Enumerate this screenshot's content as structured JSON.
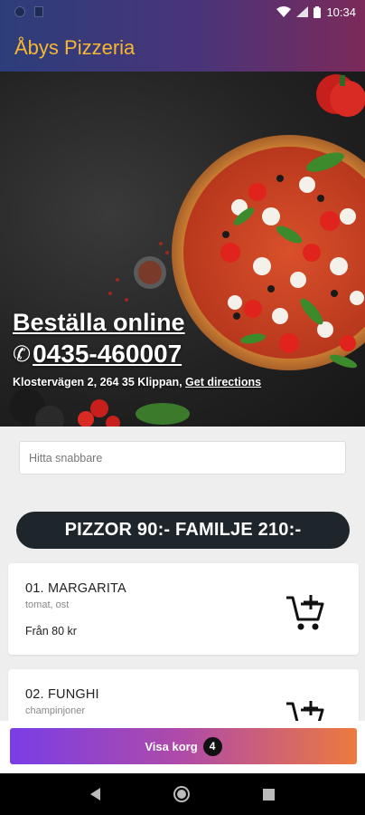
{
  "status_bar": {
    "time": "10:34",
    "left_icons": [
      "notification-dot-icon",
      "sd-card-icon"
    ],
    "right_icons": [
      "wifi-icon",
      "signal-icon",
      "battery-icon"
    ]
  },
  "app_bar": {
    "title": "Åbys Pizzeria"
  },
  "hero": {
    "title": "Beställa online",
    "phone_icon": "phone-icon",
    "phone": "0435-460007",
    "address": "Klostervägen 2, 264 35 Klippan, ",
    "directions_label": "Get directions"
  },
  "search": {
    "placeholder": "Hitta snabbare",
    "value": ""
  },
  "banner": {
    "text": "PIZZOR 90:- FAMILJE 210:-"
  },
  "menu_items": [
    {
      "name": "01. MARGARITA",
      "description": "tomat, ost",
      "price": "Från 80 kr",
      "icon": "add-to-cart-icon"
    },
    {
      "name": "02. FUNGHI",
      "description": "champinjoner",
      "price": "",
      "icon": "add-to-cart-icon"
    }
  ],
  "cart_button": {
    "label": "Visa korg",
    "count": "4"
  },
  "nav_bar": {
    "icons": [
      "back-icon",
      "home-icon",
      "recents-icon"
    ]
  },
  "colors": {
    "app_title": "#f6b731",
    "banner_bg": "#1e262b",
    "cart_gradient_start": "#7a3de6",
    "cart_gradient_end": "#ec7a3f"
  }
}
